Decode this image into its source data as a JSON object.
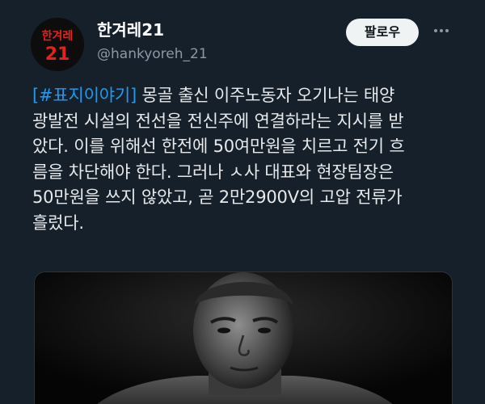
{
  "author": {
    "name": "한겨레21",
    "handle": "@hankyoreh_21",
    "avatar_logo_line1": "한겨레",
    "avatar_logo_line2": "21"
  },
  "follow_label": "팔로우",
  "more_icon": "more-horizontal-icon",
  "tweet": {
    "hashtag_open": "[",
    "hashtag": "#표지이야기",
    "hashtag_close": "]",
    "line1_rest": " 몽골 출신 이주노동자 오기나는 태양",
    "line2": "광발전 시설의 전선을 전신주에 연결하라는 지시를 받",
    "line3": "았다. 이를 위해선 한전에 50여만원을 치르고 전기 흐",
    "line4": "름을 차단해야 한다. 그러나 ㅅ사 대표와 현장팀장은",
    "line5": "50만원을 쓰지 않았고, 곧 2만2900V의 고압 전류가",
    "line6": "흘렀다."
  },
  "colors": {
    "background": "#15202b",
    "hashtag": "#1d9bf0",
    "brand_red": "#e2231a"
  }
}
